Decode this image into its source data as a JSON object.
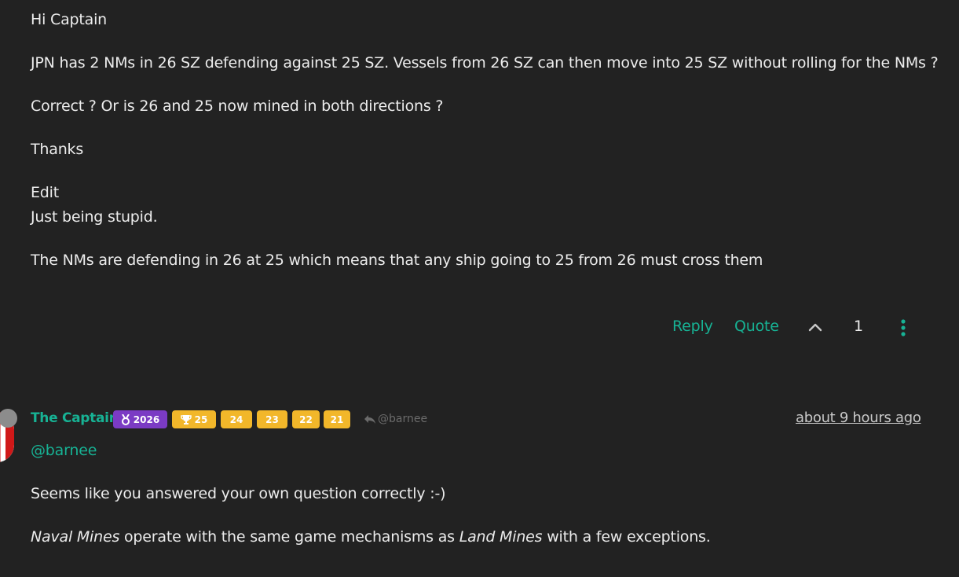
{
  "post1": {
    "paragraphs": [
      "Hi Captain",
      "JPN has 2 NMs in 26 SZ defending against 25 SZ. Vessels from 26 SZ can then move into 25 SZ without rolling for the NMs ?",
      "Correct ? Or is 26 and 25 now mined in both directions ?",
      "Thanks"
    ],
    "edit_label": "Edit",
    "edit_line": "Just being stupid.",
    "last_paragraph": "The NMs are defending in 26 at 25 which means that any ship going to 25 from 26 must cross them",
    "actions": {
      "reply_label": "Reply",
      "quote_label": "Quote",
      "upvote_icon": "chevron-up-icon",
      "vote_count": "1",
      "more_icon": "vertical-dots-icon"
    }
  },
  "post2": {
    "author": "The Captain",
    "badges": [
      {
        "icon": "medal-icon",
        "label": "2026",
        "color": "#7b3bc4"
      },
      {
        "icon": "trophy-icon",
        "label": "25",
        "color": "#f2b72a"
      },
      {
        "icon": "",
        "label": "24",
        "color": "#f2b72a"
      },
      {
        "icon": "",
        "label": "23",
        "color": "#f2b72a"
      },
      {
        "icon": "",
        "label": "22",
        "color": "#f2b72a"
      },
      {
        "icon": "",
        "label": "21",
        "color": "#f2b72a"
      }
    ],
    "reply_to": "@barnee",
    "timestamp": "about 9 hours ago",
    "mention": "@barnee",
    "line1": "Seems like you answered your own question correctly :-)",
    "line2_em1": "Naval Mines",
    "line2_mid": " operate with the same game mechanisms as ",
    "line2_em2": "Land Mines",
    "line2_end": " with a few exceptions."
  },
  "colors": {
    "background": "#222222",
    "accent": "#17b294",
    "badge_purple": "#7b3bc4",
    "badge_yellow": "#f2b72a"
  }
}
